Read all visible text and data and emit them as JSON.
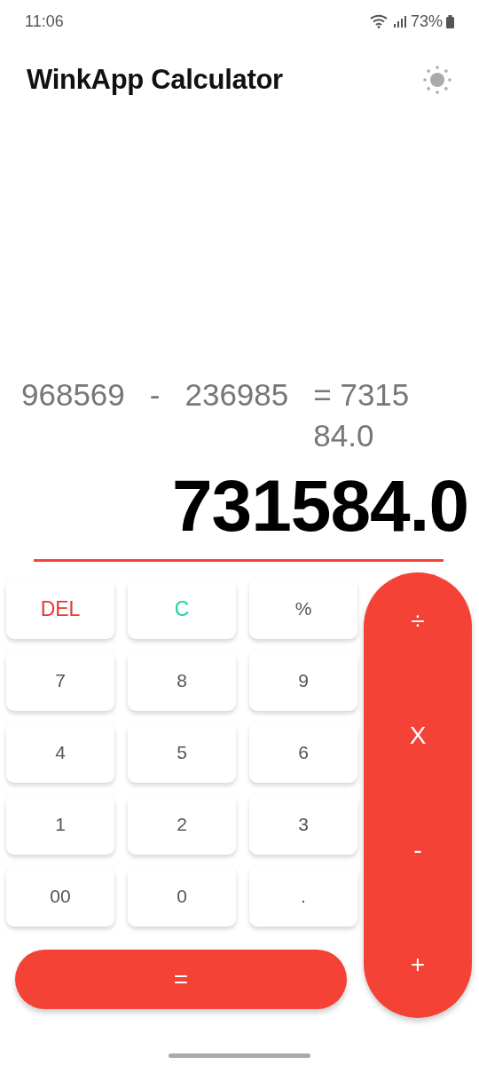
{
  "status_bar": {
    "time": "11:06",
    "battery": "73%"
  },
  "app_bar": {
    "title": "WinkApp Calculator"
  },
  "expression": {
    "operand_a": "968569",
    "operator": "-",
    "operand_b": "236985",
    "result": "= 731584.0"
  },
  "result": "731584.0",
  "keys": [
    {
      "label": "DEL",
      "kind": "delete"
    },
    {
      "label": "C",
      "kind": "clear"
    },
    {
      "label": "%",
      "kind": "digit"
    },
    {
      "label": "7",
      "kind": "digit"
    },
    {
      "label": "8",
      "kind": "digit"
    },
    {
      "label": "9",
      "kind": "digit"
    },
    {
      "label": "4",
      "kind": "digit"
    },
    {
      "label": "5",
      "kind": "digit"
    },
    {
      "label": "6",
      "kind": "digit"
    },
    {
      "label": "1",
      "kind": "digit"
    },
    {
      "label": "2",
      "kind": "digit"
    },
    {
      "label": "3",
      "kind": "digit"
    },
    {
      "label": "00",
      "kind": "digit"
    },
    {
      "label": "0",
      "kind": "digit"
    },
    {
      "label": ".",
      "kind": "digit"
    }
  ],
  "equals": "=",
  "operators": [
    "÷",
    "X",
    "-",
    "+"
  ]
}
